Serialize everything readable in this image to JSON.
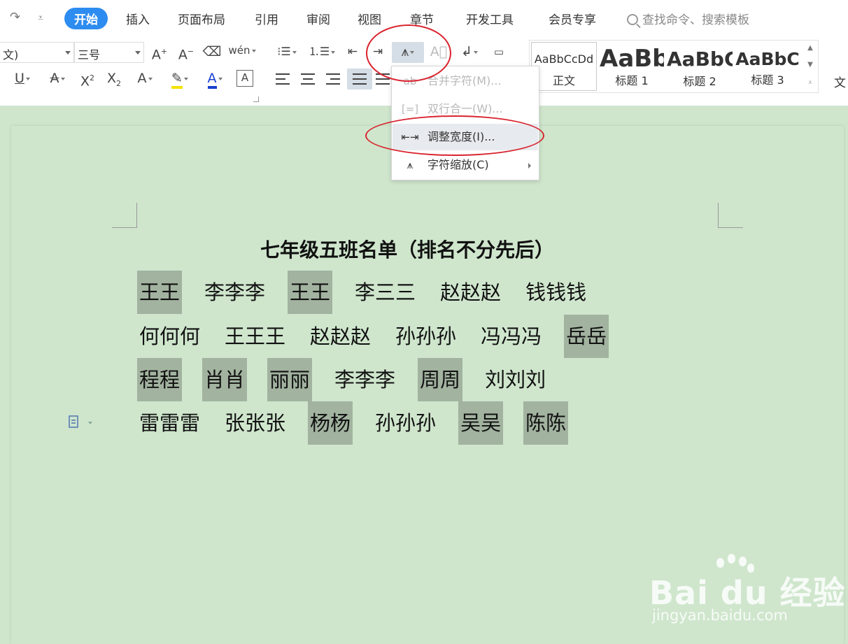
{
  "menubar": {
    "redo_icon": "redo-icon",
    "more_icon": "dropdown-arrow-icon",
    "tabs": [
      "开始",
      "插入",
      "页面布局",
      "引用",
      "审阅",
      "视图",
      "章节",
      "开发工具",
      "会员专享"
    ],
    "active_tab": "开始",
    "search_placeholder": "查找命令、搜索模板"
  },
  "font": {
    "name": "文)",
    "size": "三号"
  },
  "styles": {
    "items": [
      {
        "sample": "AaBbCcDd",
        "label": "正文"
      },
      {
        "sample": "AaBb",
        "label": "标题 1"
      },
      {
        "sample": "AaBbC",
        "label": "标题 2"
      },
      {
        "sample": "AaBbC",
        "label": "标题 3"
      }
    ],
    "more_label": "文"
  },
  "dropdown": {
    "items": [
      {
        "label": "合并字符(M)...",
        "enabled": false
      },
      {
        "label": "双行合一(W)...",
        "enabled": false
      },
      {
        "label": "调整宽度(I)...",
        "enabled": true,
        "highlighted": true
      },
      {
        "label": "字符缩放(C)",
        "enabled": true,
        "submenu": true
      }
    ]
  },
  "document": {
    "title": "七年级五班名单（排名不分先后）",
    "rows": [
      [
        {
          "t": "王王",
          "hl": true
        },
        {
          "t": "李李李",
          "hl": false
        },
        {
          "t": "王王",
          "hl": true
        },
        {
          "t": "李三三",
          "hl": false
        },
        {
          "t": "赵赵赵",
          "hl": false
        },
        {
          "t": "钱钱钱",
          "hl": false
        }
      ],
      [
        {
          "t": "何何何",
          "hl": false
        },
        {
          "t": "王王王",
          "hl": false
        },
        {
          "t": "赵赵赵",
          "hl": false
        },
        {
          "t": "孙孙孙",
          "hl": false
        },
        {
          "t": "冯冯冯",
          "hl": false
        },
        {
          "t": "岳岳",
          "hl": true
        }
      ],
      [
        {
          "t": "程程",
          "hl": true
        },
        {
          "t": "肖肖",
          "hl": true
        },
        {
          "t": "丽丽",
          "hl": true
        },
        {
          "t": "李李李",
          "hl": false
        },
        {
          "t": "周周",
          "hl": true
        },
        {
          "t": "刘刘刘",
          "hl": false
        }
      ],
      [
        {
          "t": "雷雷雷",
          "hl": false
        },
        {
          "t": "张张张",
          "hl": false
        },
        {
          "t": "杨杨",
          "hl": true
        },
        {
          "t": "孙孙孙",
          "hl": false
        },
        {
          "t": "吴吴",
          "hl": true
        },
        {
          "t": "陈陈",
          "hl": true
        }
      ]
    ]
  },
  "watermark": {
    "main": "Bai du 经验",
    "sub": "jingyan.baidu.com"
  },
  "colors": {
    "accent": "#2d8cf0",
    "annotation": "#d9232e",
    "page_bg": "#cfe6cd",
    "name_highlight": "#a2b3a0"
  }
}
